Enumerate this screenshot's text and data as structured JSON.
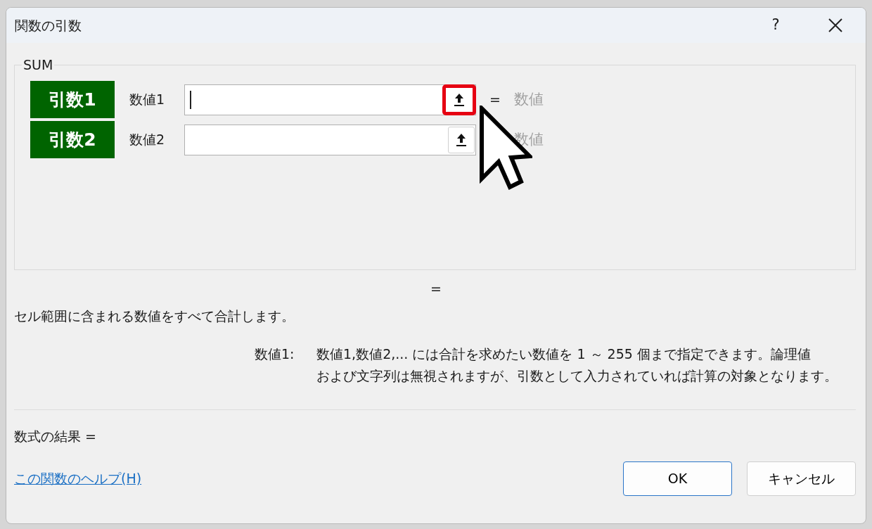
{
  "window": {
    "title": "関数の引数",
    "help_button": "?"
  },
  "group": {
    "legend": "SUM",
    "arguments": [
      {
        "tag": "引数1",
        "label": "数値1",
        "caret": true,
        "highlighted": true,
        "equals": "=",
        "result": "数値"
      },
      {
        "tag": "引数2",
        "label": "数値2",
        "caret": false,
        "highlighted": false,
        "result": "数値"
      }
    ]
  },
  "formula_value": "=",
  "description": "セル範囲に含まれる数値をすべて合計します。",
  "argument_help": {
    "label": "数値1:",
    "lines": [
      "数値1,数値2,... には合計を求めたい数値を 1 ～ 255 個まで指定できます。論理値",
      "および文字列は無視されますが、引数として入力されていれば計算の対象となります。"
    ]
  },
  "formula_result": "数式の結果 =",
  "help_link": "この関数のヘルプ(H)",
  "buttons": [
    {
      "label": "OK",
      "default": true
    },
    {
      "label": "キャンセル",
      "default": false
    }
  ]
}
